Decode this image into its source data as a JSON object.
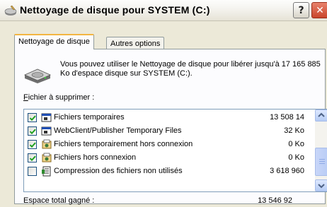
{
  "window": {
    "title": "Nettoyage de disque pour SYSTEM (C:)",
    "help_label": "?",
    "close_label": "✕"
  },
  "tabs": [
    {
      "label": "Nettoyage de disque",
      "active": true
    },
    {
      "label": "Autres options",
      "active": false
    }
  ],
  "description": "Vous pouvez utiliser le Nettoyage de disque pour libérer jusqu'à 17 165 885 Ko d'espace disque sur SYSTEM (C:).",
  "files_label_first": "F",
  "files_label_rest": "ichier à supprimer :",
  "files": [
    {
      "name": "Fichiers temporaires",
      "size": "13 508 14",
      "checked": true,
      "icon": "temp-file-icon"
    },
    {
      "name": "WebClient/Publisher Temporary Files",
      "size": "32 Ko",
      "checked": true,
      "icon": "temp-file-icon"
    },
    {
      "name": "Fichiers temporairement hors connexion",
      "size": "0 Ko",
      "checked": true,
      "icon": "offline-files-icon"
    },
    {
      "name": "Fichiers hors connexion",
      "size": "0 Ko",
      "checked": true,
      "icon": "offline-files-icon"
    },
    {
      "name": "Compression des fichiers non utilisés",
      "size": "3 618 960",
      "checked": false,
      "icon": "compress-icon"
    }
  ],
  "total": {
    "label": "Espace total gagné :",
    "value": "13 546 92"
  },
  "colors": {
    "accent": "#F3B642",
    "checkmark": "#21A121",
    "border": "#7F9DB9"
  }
}
